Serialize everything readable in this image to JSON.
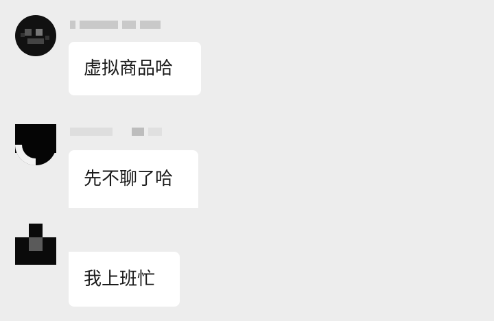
{
  "messages": [
    {
      "text": "虚拟商品哈"
    },
    {
      "text": "先不聊了哈"
    },
    {
      "text": "我上班忙"
    }
  ],
  "colors": {
    "background": "#ededed",
    "bubble": "#ffffff",
    "text": "#1b1b1b"
  }
}
